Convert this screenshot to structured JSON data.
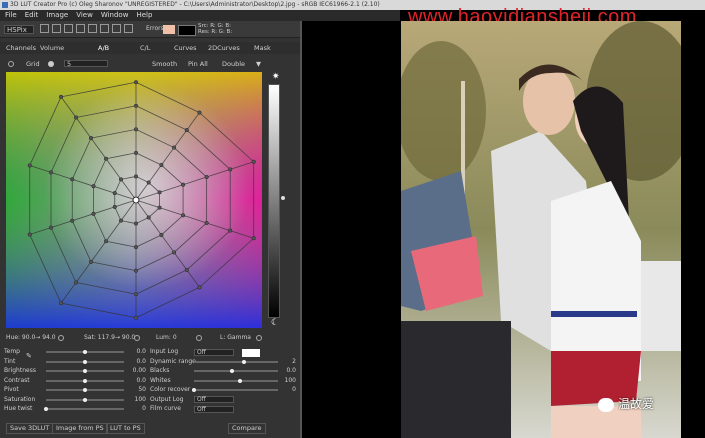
{
  "window": {
    "title": "3D LUT Creator Pro (c) Oleg Sharonov \"UNREGISTERED\" - C:\\Users\\Administrator\\Desktop\\2.jpg - sRGB IEC61966-2.1 (2.10)"
  },
  "watermark": "www.haoyidianshejj.com",
  "menu": [
    "File",
    "Edit",
    "Image",
    "View",
    "Window",
    "Help"
  ],
  "toolbar": {
    "mode_select": "HSPix",
    "readout_line1": "Src: R: G: B:",
    "readout_line2": "Res: R: G: B:",
    "mode_label": "Errors"
  },
  "tabs": [
    "Channels",
    "Volume",
    "A/B",
    "C/L",
    "Curves",
    "2DCurves",
    "Mask"
  ],
  "options": {
    "grid_label": "Grid",
    "grid_value": "5",
    "smooth": "Smooth",
    "pin_all": "Pin All",
    "double": "Double"
  },
  "status": {
    "hue": "Hue: 90.0→ 94.0",
    "sat": "Sat: 117.9→ 90.0",
    "lum": "Lum: 0",
    "gamma": "L: Gamma"
  },
  "adjust_left": [
    {
      "label": "Temp",
      "value": "0.0",
      "pos": 0.5
    },
    {
      "label": "Tint",
      "value": "0.0",
      "pos": 0.5
    },
    {
      "label": "Brightness",
      "value": "0.00",
      "pos": 0.5
    },
    {
      "label": "Contrast",
      "value": "0.0",
      "pos": 0.5
    },
    {
      "label": "Pivot",
      "value": "50",
      "pos": 0.5
    },
    {
      "label": "Saturation",
      "value": "100",
      "pos": 0.5
    },
    {
      "label": "Hue twist",
      "value": "0",
      "pos": 0.0
    }
  ],
  "adjust_right": [
    {
      "label": "Input Log",
      "kind": "select",
      "value": "Off"
    },
    {
      "label": "Dynamic range",
      "kind": "slider",
      "value": "2",
      "pos": 0.6
    },
    {
      "label": "Blacks",
      "kind": "slider",
      "value": "0.0",
      "pos": 0.45
    },
    {
      "label": "Whites",
      "kind": "slider",
      "value": "100",
      "pos": 0.55
    },
    {
      "label": "Color recover",
      "kind": "slider",
      "value": "0",
      "pos": 0.0
    },
    {
      "label": "Output Log",
      "kind": "select",
      "value": "Off"
    },
    {
      "label": "Film curve",
      "kind": "select",
      "value": "Off"
    }
  ],
  "bottom_buttons": [
    "Save 3DLUT",
    "Image from PS",
    "LUT to PS",
    "Compare"
  ],
  "wechat_text": "温故爱",
  "colors": {
    "accent_red": "#e0242a",
    "panel": "#333333"
  }
}
